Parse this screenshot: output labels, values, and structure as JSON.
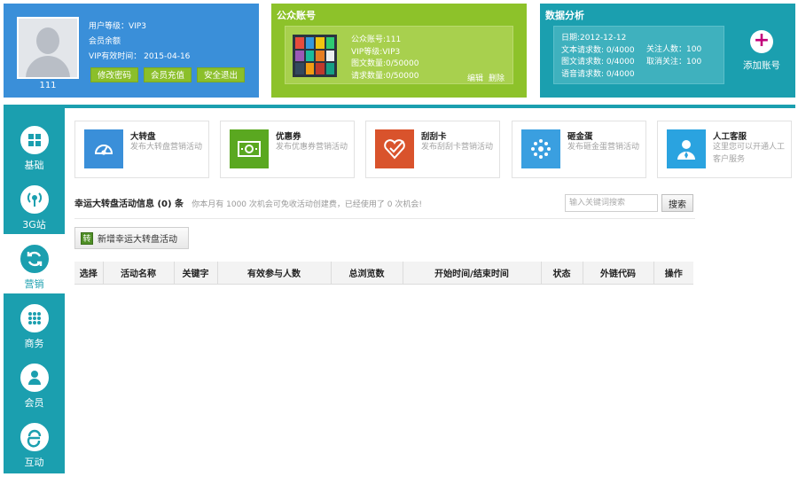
{
  "user_panel": {
    "username": "111",
    "level_text": "用户等级：VIP3",
    "balance_text": "会员余额",
    "vip_expiry_text": "VIP有效时间： 2015-04-16",
    "buttons": [
      "修改密码",
      "会员充值",
      "安全退出"
    ],
    "color": "#3a8fd9"
  },
  "account_panel": {
    "title": "公众账号",
    "account_line": "公众账号:111",
    "vip_line": "VIP等级:VIP3",
    "graphic_line": "图文数量:0/50000",
    "request_line": "请求数量:0/50000",
    "edit_label": "编辑",
    "delete_label": "删除",
    "color": "#8dc22a"
  },
  "stats_panel": {
    "title": "数据分析",
    "date_line": "日期:2012-12-12",
    "text_requests": "文本请求数: 0/4000",
    "graphic_requests": "图文请求数: 0/4000",
    "voice_requests": "语音请求数: 0/4000",
    "followers": "关注人数：100",
    "unfollows": "取消关注：100",
    "add_account_label": "添加账号",
    "color": "#1b9faf"
  },
  "sidebar": {
    "items": [
      {
        "label": "基础",
        "icon": "grid-icon"
      },
      {
        "label": "3G站",
        "icon": "signal-icon"
      },
      {
        "label": "营销",
        "icon": "refresh-icon",
        "active": true
      },
      {
        "label": "商务",
        "icon": "dots-icon"
      },
      {
        "label": "会员",
        "icon": "user-icon"
      },
      {
        "label": "互动",
        "icon": "browser-icon"
      }
    ]
  },
  "cards": [
    {
      "title": "大转盘",
      "desc": "发布大转盘营销活动",
      "color": "#3a8fd9",
      "icon": "dial-icon"
    },
    {
      "title": "优惠券",
      "desc": "发布优惠券营销活动",
      "color": "#5aa820",
      "icon": "coupon-icon"
    },
    {
      "title": "刮刮卡",
      "desc": "发布刮刮卡营销活动",
      "color": "#d9532c",
      "icon": "heart-check-icon"
    },
    {
      "title": "砸金蛋",
      "desc": "发布砸金蛋营销活动",
      "color": "#3a9fe0",
      "icon": "burst-icon"
    },
    {
      "title": "人工客服",
      "desc": "这里您可以开通人工客户服务",
      "color": "#2aa3e0",
      "icon": "agent-icon"
    }
  ],
  "info": {
    "title": "幸运大转盘活动信息 (0) 条",
    "note": "你本月有 1000 次机会可免收活动创建费，已经使用了 0 次机会!"
  },
  "search": {
    "placeholder": "输入关键词搜索",
    "button_label": "搜索"
  },
  "add_activity_label": "新增幸运大转盘活动",
  "table": {
    "headers": [
      "选择",
      "活动名称",
      "关键字",
      "有效参与人数",
      "总浏览数",
      "开始时间/结束时间",
      "状态",
      "外链代码",
      "操作"
    ]
  }
}
